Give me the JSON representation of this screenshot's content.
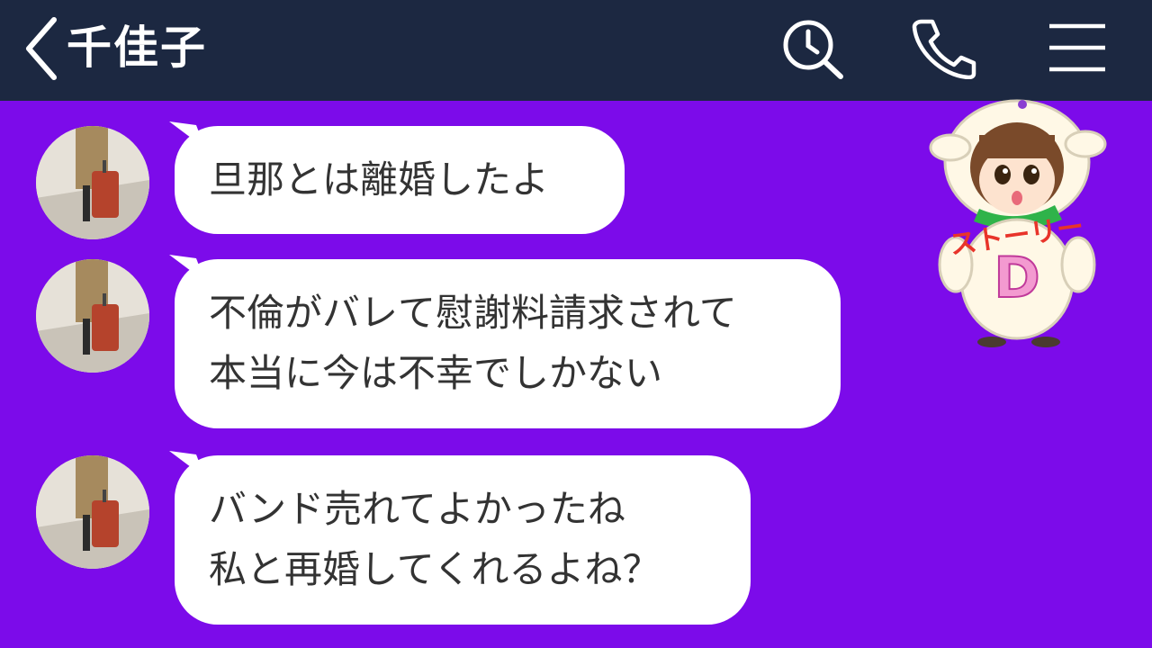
{
  "header": {
    "title": "千佳子",
    "icons": [
      "back-chevron-icon",
      "search-history-icon",
      "phone-icon",
      "menu-icon"
    ]
  },
  "messages": [
    {
      "sender": "千佳子",
      "lines": [
        "旦那とは離婚したよ"
      ]
    },
    {
      "sender": "千佳子",
      "lines": [
        "不倫がバレて慰謝料請求されて",
        "本当に今は不幸でしかない"
      ]
    },
    {
      "sender": "千佳子",
      "lines": [
        "バンド売れてよかったね",
        "私と再婚してくれるよね？"
      ]
    }
  ],
  "mascot": {
    "sign_text": "ストーリー",
    "letter": "D"
  },
  "colors": {
    "header_bg": "#1c2841",
    "chat_bg": "#7c0bea",
    "bubble_bg": "#ffffff",
    "text": "#333333"
  }
}
